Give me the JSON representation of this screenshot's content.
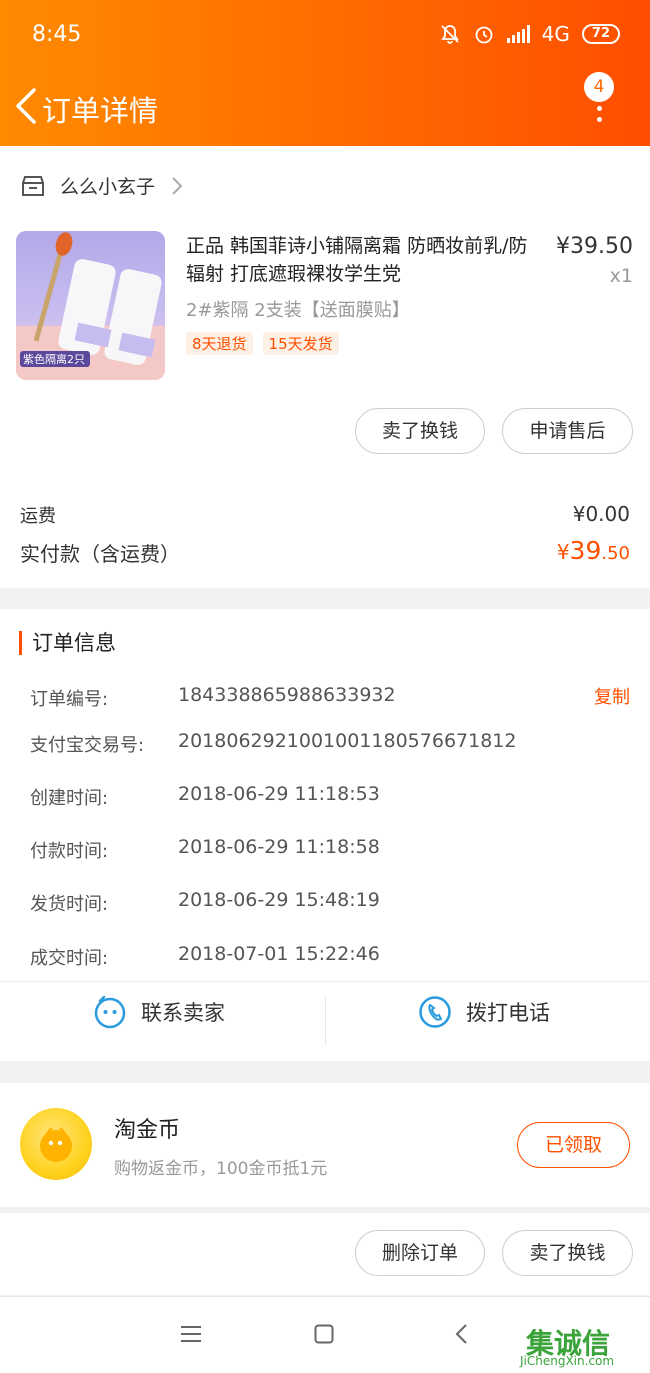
{
  "status_bar": {
    "time": "8:45",
    "network": "4G",
    "battery": "72"
  },
  "nav": {
    "title": "订单详情",
    "badge": "4"
  },
  "shop": {
    "name": "么么小玄子"
  },
  "product": {
    "title": "正品 韩国菲诗小铺隔离霜 防晒妆前乳/防辐射 打底遮瑕裸妆学生党",
    "price": "¥39.50",
    "qty": "x1",
    "sku": "2#紫隔 2支装【送面膜贴】",
    "tags": [
      "8天退货",
      "15天发货"
    ],
    "image_caption": "紫色隔离2只"
  },
  "item_actions": {
    "sell_label": "卖了换钱",
    "after_sale_label": "申请售后"
  },
  "totals": {
    "shipping_label": "运费",
    "shipping_value": "¥0.00",
    "paid_label": "实付款（含运费）",
    "paid_symbol": "¥",
    "paid_int": "39",
    "paid_dec": ".50"
  },
  "order_info": {
    "title": "订单信息",
    "copy_label": "复制",
    "rows": [
      {
        "label": "订单编号:",
        "value": "184338865988633932"
      },
      {
        "label": "支付宝交易号:",
        "value": "2018062921001001180576671812"
      },
      {
        "label": "创建时间:",
        "value": "2018-06-29 11:18:53"
      },
      {
        "label": "付款时间:",
        "value": "2018-06-29 11:18:58"
      },
      {
        "label": "发货时间:",
        "value": "2018-06-29 15:48:19"
      },
      {
        "label": "成交时间:",
        "value": "2018-07-01 15:22:46"
      }
    ]
  },
  "contact": {
    "seller_label": "联系卖家",
    "call_label": "拨打电话"
  },
  "coin": {
    "title": "淘金币",
    "subtitle": "购物返金币，100金币抵1元",
    "button": "已领取"
  },
  "bottom_actions": {
    "delete_label": "删除订单",
    "sell_label": "卖了换钱"
  },
  "watermark": {
    "text": "集诚信",
    "sub": "JiChengXin.com"
  },
  "colors": {
    "accent": "#ff5000",
    "header_start": "#ff8a00",
    "header_end": "#ff4e00",
    "icon_blue": "#2a9bdc"
  }
}
